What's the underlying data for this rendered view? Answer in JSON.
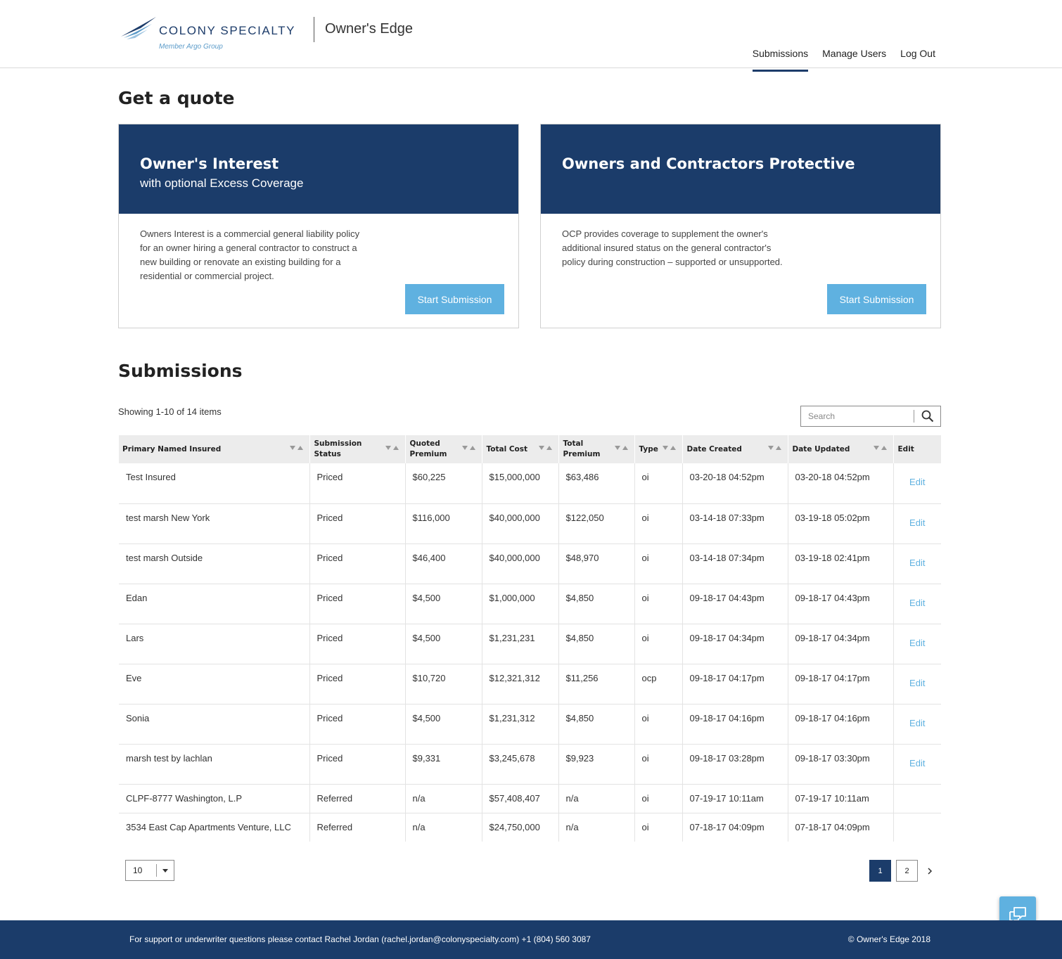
{
  "header": {
    "brand_name": "COLONY SPECIALTY",
    "brand_sub": "Member Argo Group",
    "product_name": "Owner's Edge",
    "nav": [
      {
        "label": "Submissions",
        "active": true
      },
      {
        "label": "Manage Users",
        "active": false
      },
      {
        "label": "Log Out",
        "active": false
      }
    ]
  },
  "quote": {
    "heading": "Get a quote",
    "cards": [
      {
        "title": "Owner's Interest",
        "subtitle": "with optional Excess Coverage",
        "description": "Owners Interest is a commercial general liability policy for an owner hiring a general contractor to construct a new building or renovate an existing building for a residential or commercial project.",
        "button": "Start Submission"
      },
      {
        "title": "Owners and Contractors Protective",
        "subtitle": "",
        "description": "OCP provides coverage to supplement the owner's additional insured status on the general contractor's policy during construction – supported or unsupported.",
        "button": "Start Submission"
      }
    ]
  },
  "submissions": {
    "heading": "Submissions",
    "showing": "Showing 1-10 of 14 items",
    "search_placeholder": "Search",
    "columns": [
      "Primary Named Insured",
      "Submission Status",
      "Quoted Premium",
      "Total Cost",
      "Total Premium",
      "Type",
      "Date Created",
      "Date Updated",
      "Edit"
    ],
    "rows": [
      {
        "insured": "Test Insured",
        "status": "Priced",
        "quoted": "$60,225",
        "cost": "$15,000,000",
        "premium": "$63,486",
        "type": "oi",
        "created": "03-20-18 04:52pm",
        "updated": "03-20-18 04:52pm",
        "edit": "Edit"
      },
      {
        "insured": "test marsh New York",
        "status": "Priced",
        "quoted": "$116,000",
        "cost": "$40,000,000",
        "premium": "$122,050",
        "type": "oi",
        "created": "03-14-18 07:33pm",
        "updated": "03-19-18 05:02pm",
        "edit": "Edit"
      },
      {
        "insured": "test marsh Outside",
        "status": "Priced",
        "quoted": "$46,400",
        "cost": "$40,000,000",
        "premium": "$48,970",
        "type": "oi",
        "created": "03-14-18 07:34pm",
        "updated": "03-19-18 02:41pm",
        "edit": "Edit"
      },
      {
        "insured": "Edan",
        "status": "Priced",
        "quoted": "$4,500",
        "cost": "$1,000,000",
        "premium": "$4,850",
        "type": "oi",
        "created": "09-18-17 04:43pm",
        "updated": "09-18-17 04:43pm",
        "edit": "Edit"
      },
      {
        "insured": "Lars",
        "status": "Priced",
        "quoted": "$4,500",
        "cost": "$1,231,231",
        "premium": "$4,850",
        "type": "oi",
        "created": "09-18-17 04:34pm",
        "updated": "09-18-17 04:34pm",
        "edit": "Edit"
      },
      {
        "insured": "Eve",
        "status": "Priced",
        "quoted": "$10,720",
        "cost": "$12,321,312",
        "premium": "$11,256",
        "type": "ocp",
        "created": "09-18-17 04:17pm",
        "updated": "09-18-17 04:17pm",
        "edit": "Edit"
      },
      {
        "insured": "Sonia",
        "status": "Priced",
        "quoted": "$4,500",
        "cost": "$1,231,312",
        "premium": "$4,850",
        "type": "oi",
        "created": "09-18-17 04:16pm",
        "updated": "09-18-17 04:16pm",
        "edit": "Edit"
      },
      {
        "insured": "marsh test by lachlan",
        "status": "Priced",
        "quoted": "$9,331",
        "cost": "$3,245,678",
        "premium": "$9,923",
        "type": "oi",
        "created": "09-18-17 03:28pm",
        "updated": "09-18-17 03:30pm",
        "edit": "Edit"
      },
      {
        "insured": "CLPF-8777 Washington, L.P",
        "status": "Referred",
        "quoted": "n/a",
        "cost": "$57,408,407",
        "premium": "n/a",
        "type": "oi",
        "created": "07-19-17 10:11am",
        "updated": "07-19-17 10:11am",
        "edit": ""
      },
      {
        "insured": "3534 East Cap Apartments Venture, LLC",
        "status": "Referred",
        "quoted": "n/a",
        "cost": "$24,750,000",
        "premium": "n/a",
        "type": "oi",
        "created": "07-18-17 04:09pm",
        "updated": "07-18-17 04:09pm",
        "edit": ""
      }
    ],
    "page_size": "10",
    "pages": [
      {
        "label": "1",
        "active": true
      },
      {
        "label": "2",
        "active": false
      }
    ]
  },
  "footer": {
    "support": "For support or underwriter questions please contact Rachel Jordan (rachel.jordan@colonyspecialty.com) +1 (804) 560 3087",
    "copyright": "© Owner's Edge 2018"
  },
  "colors": {
    "navy": "#1b3c6a",
    "accent_blue": "#5fb1e0",
    "header_row": "#ececec"
  },
  "icons": {
    "search": "search-icon",
    "sort": "sort-arrows-icon",
    "next": "chevron-right-icon",
    "dropdown": "caret-down-icon",
    "chat": "chat-bubbles-icon"
  }
}
